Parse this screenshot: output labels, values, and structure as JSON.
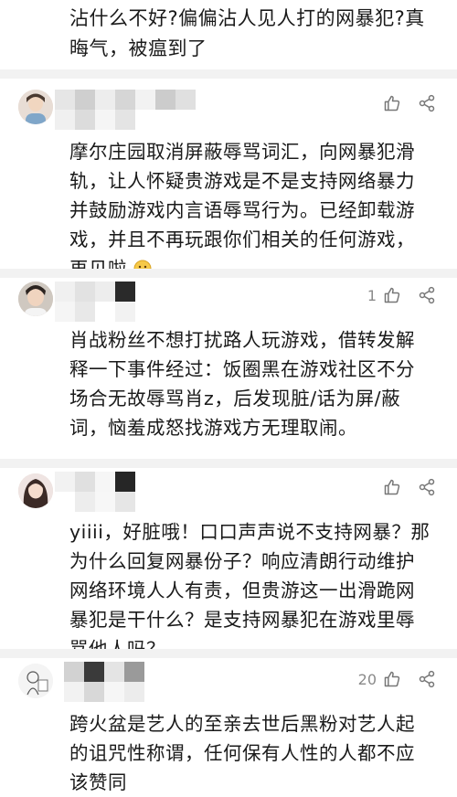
{
  "fragment": {
    "text": "沾什么不好?偏偏沾人见人打的网暴犯?真晦气，被瘟到了"
  },
  "comments": [
    {
      "likes": "",
      "text": "摩尔庄园取消屏蔽辱骂词汇，向网暴犯滑轨，让人怀疑贵游戏是不是支持网络暴力并鼓励游戏内言语辱骂行为。已经卸载游戏，并且不再玩跟你们相关的任何游戏，再见啦"
    },
    {
      "likes": "1",
      "text": "肖战粉丝不想打扰路人玩游戏，借转发解释一下事件经过：饭圈黑在游戏社区不分场合无故辱骂肖z，后发现脏/话为屏/蔽词，恼羞成怒找游戏方无理取闹。"
    },
    {
      "likes": "",
      "text": "yiiii，好脏哦！口口声声说不支持网暴？那为什么回复网暴份子？响应清朗行动维护网络环境人人有责，但贵游这一出滑跪网暴犯是干什么？是支持网暴犯在游戏里辱骂他人吗？"
    },
    {
      "likes": "20",
      "text": "跨火盆是艺人的至亲去世后黑粉对艺人起的诅咒性称谓，任何保有人性的人都不应该赞同"
    }
  ],
  "icons": {
    "like": "thumbs-up-icon",
    "share": "share-icon",
    "emoji": "smile-emoji-icon"
  },
  "colors": {
    "divider": "#f2f2f2",
    "text": "#1a1a1a",
    "muted": "#8a8a8a"
  }
}
